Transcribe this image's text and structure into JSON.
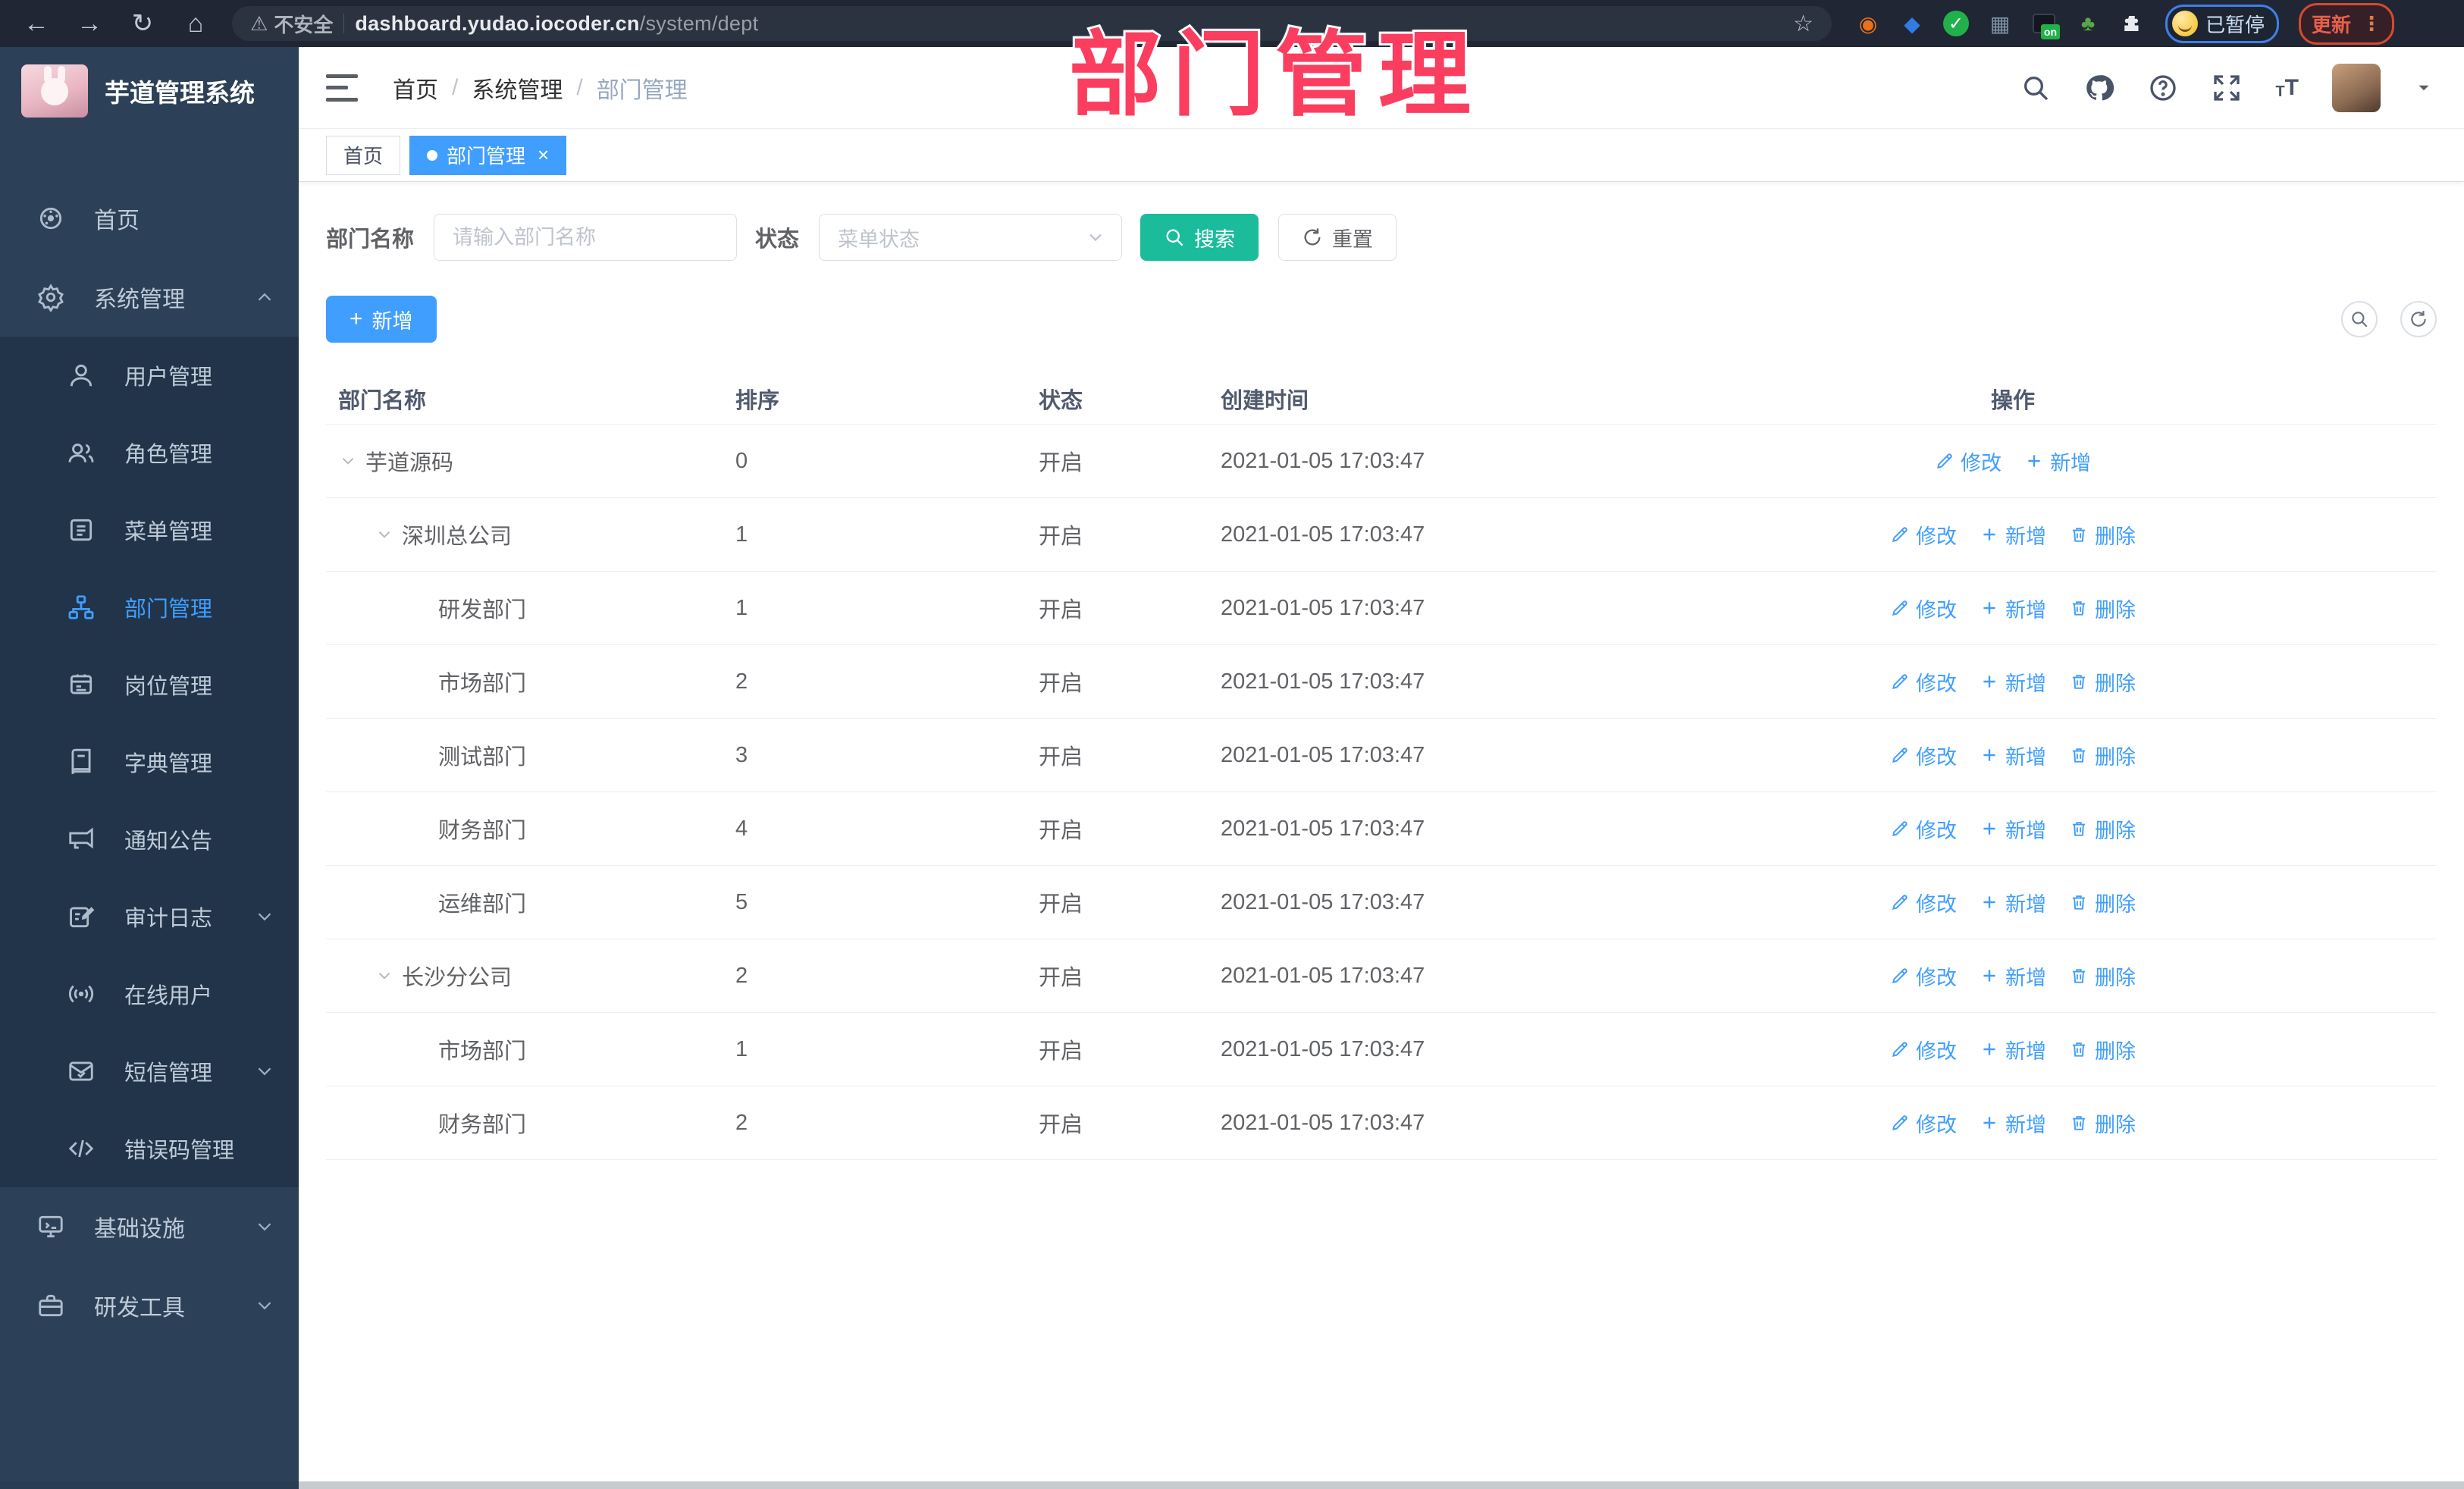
{
  "browser": {
    "security_label": "不安全",
    "url_host": "dashboard.yudao.iocoder.cn",
    "url_path": "/system/dept",
    "paused_label": "已暂停",
    "update_label": "更新",
    "update_menu_glyph": "⋮"
  },
  "annotation": {
    "text": "部门管理",
    "color": "#fb3d5f"
  },
  "sidebar": {
    "title": "芋道管理系统",
    "items": [
      {
        "label": "首页",
        "icon": "dashboard-icon",
        "level": "top"
      },
      {
        "label": "系统管理",
        "icon": "gear-icon",
        "level": "top",
        "chevron": "up"
      },
      {
        "label": "用户管理",
        "icon": "user-icon",
        "level": "sub"
      },
      {
        "label": "角色管理",
        "icon": "users-icon",
        "level": "sub"
      },
      {
        "label": "菜单管理",
        "icon": "menu-list-icon",
        "level": "sub"
      },
      {
        "label": "部门管理",
        "icon": "org-tree-icon",
        "level": "sub",
        "active": true
      },
      {
        "label": "岗位管理",
        "icon": "badge-icon",
        "level": "sub"
      },
      {
        "label": "字典管理",
        "icon": "dictionary-icon",
        "level": "sub"
      },
      {
        "label": "通知公告",
        "icon": "announcement-icon",
        "level": "sub"
      },
      {
        "label": "审计日志",
        "icon": "audit-log-icon",
        "level": "sub",
        "chevron": "down"
      },
      {
        "label": "在线用户",
        "icon": "online-users-icon",
        "level": "sub"
      },
      {
        "label": "短信管理",
        "icon": "sms-icon",
        "level": "sub",
        "chevron": "down"
      },
      {
        "label": "错误码管理",
        "icon": "error-code-icon",
        "level": "sub"
      },
      {
        "label": "基础设施",
        "icon": "infrastructure-icon",
        "level": "top",
        "chevron": "down"
      },
      {
        "label": "研发工具",
        "icon": "dev-tools-icon",
        "level": "top",
        "chevron": "down"
      }
    ]
  },
  "header": {
    "breadcrumb": [
      "首页",
      "系统管理",
      "部门管理"
    ]
  },
  "tabs": [
    {
      "label": "首页",
      "active": false
    },
    {
      "label": "部门管理",
      "active": true,
      "closable": true
    }
  ],
  "filters": {
    "name_label": "部门名称",
    "name_placeholder": "请输入部门名称",
    "name_value": "",
    "status_label": "状态",
    "status_placeholder": "菜单状态",
    "search_label": "搜索",
    "reset_label": "重置"
  },
  "toolbar": {
    "add_label": "新增"
  },
  "actions": {
    "edit": "修改",
    "add": "新增",
    "delete": "删除"
  },
  "table": {
    "columns": [
      "部门名称",
      "排序",
      "状态",
      "创建时间",
      "操作"
    ],
    "rows": [
      {
        "name": "芋道源码",
        "level": 0,
        "expandable": true,
        "sort": "0",
        "status": "开启",
        "created": "2021-01-05 17:03:47",
        "actions": [
          "修改",
          "新增"
        ]
      },
      {
        "name": "深圳总公司",
        "level": 1,
        "expandable": true,
        "sort": "1",
        "status": "开启",
        "created": "2021-01-05 17:03:47",
        "actions": [
          "修改",
          "新增",
          "删除"
        ]
      },
      {
        "name": "研发部门",
        "level": 2,
        "expandable": false,
        "sort": "1",
        "status": "开启",
        "created": "2021-01-05 17:03:47",
        "actions": [
          "修改",
          "新增",
          "删除"
        ]
      },
      {
        "name": "市场部门",
        "level": 2,
        "expandable": false,
        "sort": "2",
        "status": "开启",
        "created": "2021-01-05 17:03:47",
        "actions": [
          "修改",
          "新增",
          "删除"
        ]
      },
      {
        "name": "测试部门",
        "level": 2,
        "expandable": false,
        "sort": "3",
        "status": "开启",
        "created": "2021-01-05 17:03:47",
        "actions": [
          "修改",
          "新增",
          "删除"
        ]
      },
      {
        "name": "财务部门",
        "level": 2,
        "expandable": false,
        "sort": "4",
        "status": "开启",
        "created": "2021-01-05 17:03:47",
        "actions": [
          "修改",
          "新增",
          "删除"
        ]
      },
      {
        "name": "运维部门",
        "level": 2,
        "expandable": false,
        "sort": "5",
        "status": "开启",
        "created": "2021-01-05 17:03:47",
        "actions": [
          "修改",
          "新增",
          "删除"
        ]
      },
      {
        "name": "长沙分公司",
        "level": 1,
        "expandable": true,
        "sort": "2",
        "status": "开启",
        "created": "2021-01-05 17:03:47",
        "actions": [
          "修改",
          "新增",
          "删除"
        ]
      },
      {
        "name": "市场部门",
        "level": 2,
        "expandable": false,
        "sort": "1",
        "status": "开启",
        "created": "2021-01-05 17:03:47",
        "actions": [
          "修改",
          "新增",
          "删除"
        ]
      },
      {
        "name": "财务部门",
        "level": 2,
        "expandable": false,
        "sort": "2",
        "status": "开启",
        "created": "2021-01-05 17:03:47",
        "actions": [
          "修改",
          "新增",
          "删除"
        ]
      }
    ]
  },
  "colors": {
    "accent_blue": "#409EFF",
    "search_teal": "#1ABC9C",
    "sidebar_bg": "#2c4157",
    "submenu_bg": "#213449",
    "chrome_bg": "#202633",
    "annotation_pink": "#fb3d5f",
    "table_text": "#606266",
    "table_header_text": "#515a6e"
  }
}
